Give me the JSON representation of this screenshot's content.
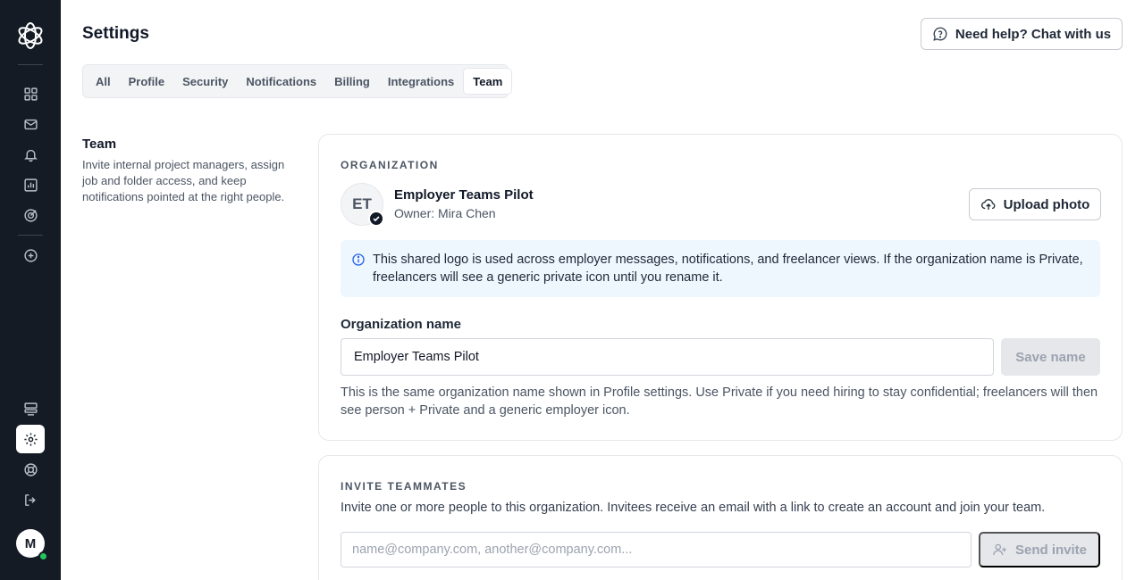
{
  "page": {
    "title": "Settings"
  },
  "header": {
    "help_label": "Need help? Chat with us"
  },
  "tabs": [
    {
      "label": "All",
      "active": false
    },
    {
      "label": "Profile",
      "active": false
    },
    {
      "label": "Security",
      "active": false
    },
    {
      "label": "Notifications",
      "active": false
    },
    {
      "label": "Billing",
      "active": false
    },
    {
      "label": "Integrations",
      "active": false
    },
    {
      "label": "Team",
      "active": true
    }
  ],
  "sidebar": {
    "top_icons": [
      "grid-icon",
      "mail-icon",
      "bell-icon",
      "chart-icon",
      "target-icon"
    ],
    "add_icon": "plus-circle-icon",
    "bottom_icons": [
      "server-icon",
      "gear-icon",
      "lifebuoy-icon",
      "logout-icon"
    ],
    "active": "gear-icon",
    "avatar_initial": "M"
  },
  "section": {
    "title": "Team",
    "description": "Invite internal project managers, assign job and folder access, and keep notifications pointed at the right people."
  },
  "organization": {
    "label": "ORGANIZATION",
    "initials": "ET",
    "name": "Employer Teams Pilot",
    "owner": "Owner: Mira Chen",
    "upload_label": "Upload photo",
    "info_text": "This shared logo is used across employer messages, notifications, and freelancer views. If the organization name is Private, freelancers will see a generic private icon until you rename it.",
    "field_label": "Organization name",
    "field_value": "Employer Teams Pilot",
    "save_label": "Save name",
    "help_text": "This is the same organization name shown in Profile settings. Use Private if you need hiring to stay confidential; freelancers will then see person + Private and a generic employer icon."
  },
  "invite": {
    "label": "INVITE TEAMMATES",
    "description": "Invite one or more people to this organization. Invitees receive an email with a link to create an account and join your team.",
    "placeholder": "name@company.com, another@company.com...",
    "send_label": "Send invite"
  },
  "colors": {
    "sidebar_bg": "#141b24",
    "info_bg": "#eef6fe",
    "info_icon": "#2563eb",
    "online": "#22c55e"
  }
}
